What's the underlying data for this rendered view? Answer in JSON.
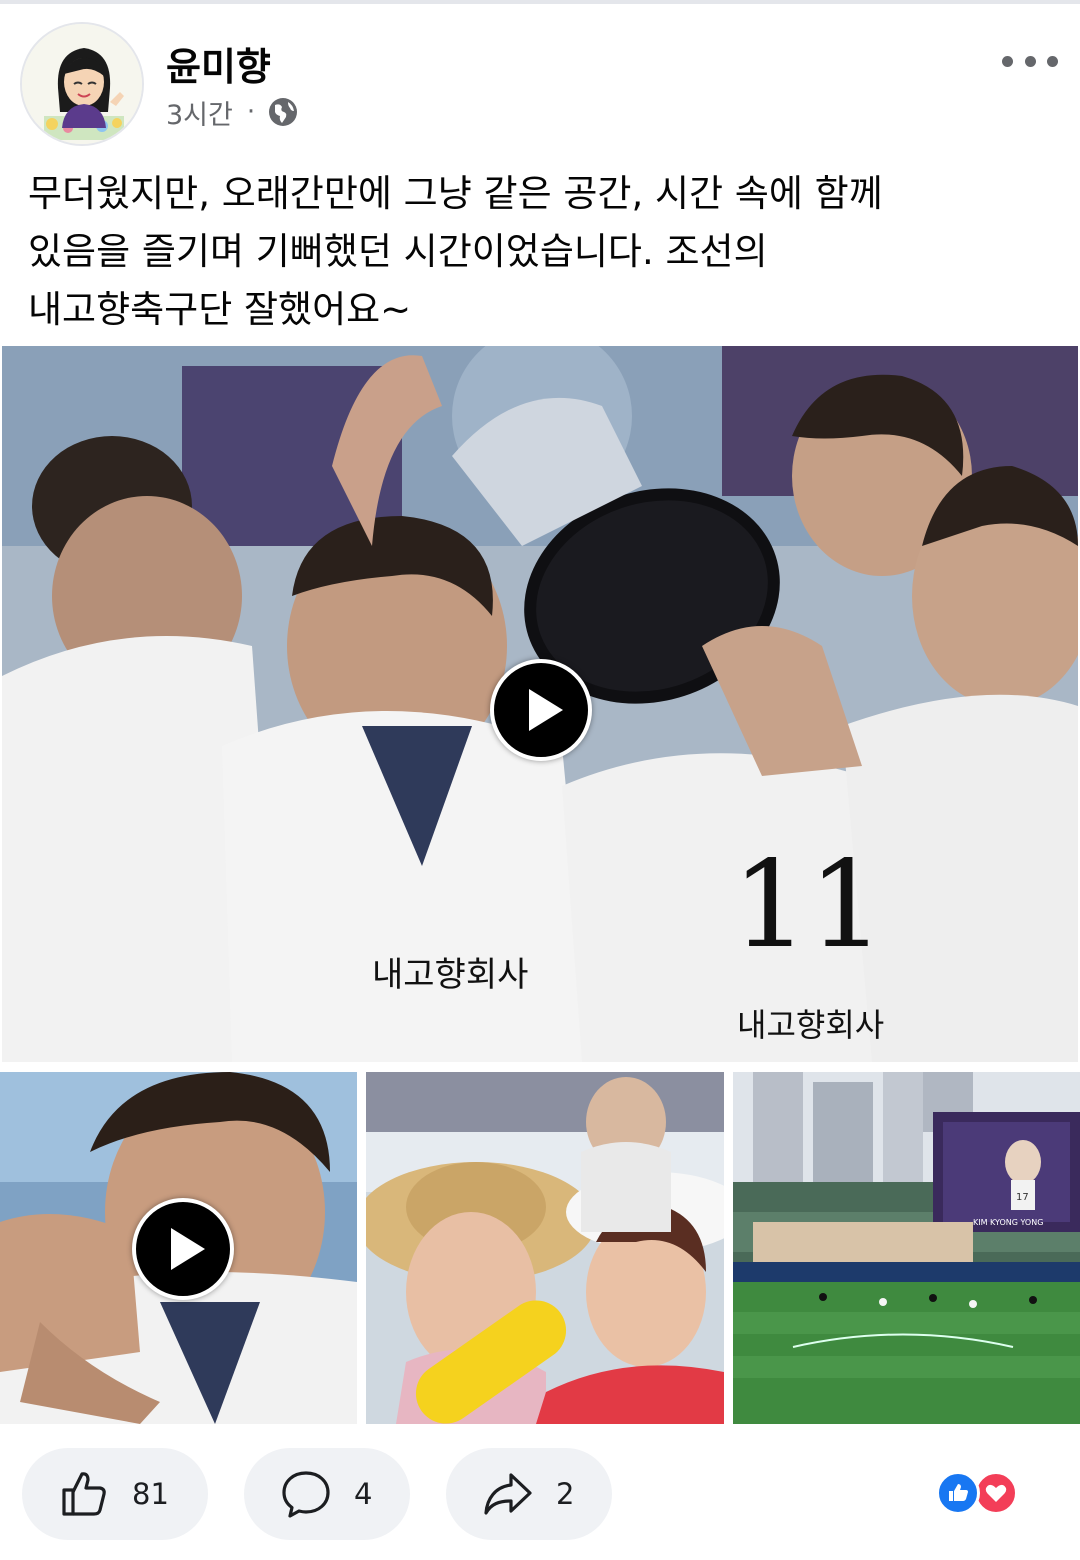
{
  "post": {
    "author": "윤미향",
    "time": "3시간",
    "separator": "·",
    "privacy_icon": "globe-icon",
    "more_icon": "more-icon",
    "text_lines": [
      "무더웠지만, 오래간만에 그냥 같은 공간, 시간 속에 함께",
      "있음을 즐기며 기뻐했던 시간이었습니다. 조선의",
      "내고향축구단 잘했어요~"
    ]
  },
  "media": {
    "main_video": {
      "play_icon": "play-icon",
      "jersey_text": "내고향회사",
      "jersey_number": "11"
    },
    "thumbnails": [
      {
        "type": "video",
        "play_icon": "play-icon"
      },
      {
        "type": "photo"
      },
      {
        "type": "photo",
        "scoreboard_text": "KIM KYONG YONG",
        "scoreboard_number": "17"
      }
    ]
  },
  "actions": {
    "like": {
      "icon": "like-icon",
      "count": "81"
    },
    "comment": {
      "icon": "comment-icon",
      "count": "4"
    },
    "share": {
      "icon": "share-icon",
      "count": "2"
    }
  },
  "reactions": [
    "like-reaction-icon",
    "love-reaction-icon"
  ],
  "colors": {
    "background": "#ffffff",
    "secondary_text": "#65676b",
    "action_pill": "#f0f2f5",
    "like_blue": "#1877f2",
    "love_red": "#f33e58"
  }
}
